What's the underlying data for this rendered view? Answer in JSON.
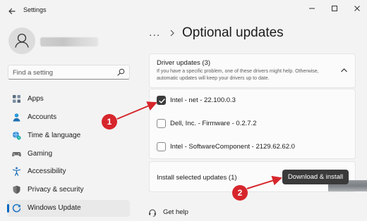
{
  "window": {
    "title": "Settings",
    "back_icon": "back-arrow-icon",
    "controls": [
      "minimize-icon",
      "maximize-icon",
      "close-icon"
    ]
  },
  "sidebar": {
    "avatar_icon": "user-avatar-icon",
    "search": {
      "placeholder": "Find a setting",
      "value": "",
      "icon": "search-icon"
    },
    "items": [
      {
        "label": "Apps",
        "icon": "apps-icon",
        "selected": false
      },
      {
        "label": "Accounts",
        "icon": "accounts-icon",
        "selected": false
      },
      {
        "label": "Time & language",
        "icon": "globe-clock-icon",
        "selected": false
      },
      {
        "label": "Gaming",
        "icon": "gamepad-icon",
        "selected": false
      },
      {
        "label": "Accessibility",
        "icon": "accessibility-icon",
        "selected": false
      },
      {
        "label": "Privacy & security",
        "icon": "shield-icon",
        "selected": false
      },
      {
        "label": "Windows Update",
        "icon": "windows-update-icon",
        "selected": true
      }
    ]
  },
  "main": {
    "breadcrumb_more": "...",
    "title": "Optional updates",
    "driver_updates": {
      "title": "Driver updates (3)",
      "description": "If you have a specific problem, one of these drivers might help. Otherwise, automatic updates will keep your drivers up to date.",
      "expanded": true,
      "drivers": [
        {
          "name": "Intel - net - 22.100.0.3",
          "checked": true
        },
        {
          "name": "Dell, Inc. - Firmware - 0.2.7.2",
          "checked": false
        },
        {
          "name": "Intel - SoftwareComponent - 2129.62.62.0",
          "checked": false
        }
      ]
    },
    "install": {
      "label": "Install selected updates (1)",
      "button_label": "Download & install"
    },
    "get_help": {
      "label": "Get help",
      "icon": "help-headset-icon"
    }
  },
  "annotations": {
    "markers": [
      "1",
      "2"
    ],
    "color": "#d6262c"
  },
  "colors": {
    "accent": "#0067c0",
    "button_dark": "#3a3a3a",
    "background": "#f3f3f3",
    "card": "#fbfbfb"
  }
}
